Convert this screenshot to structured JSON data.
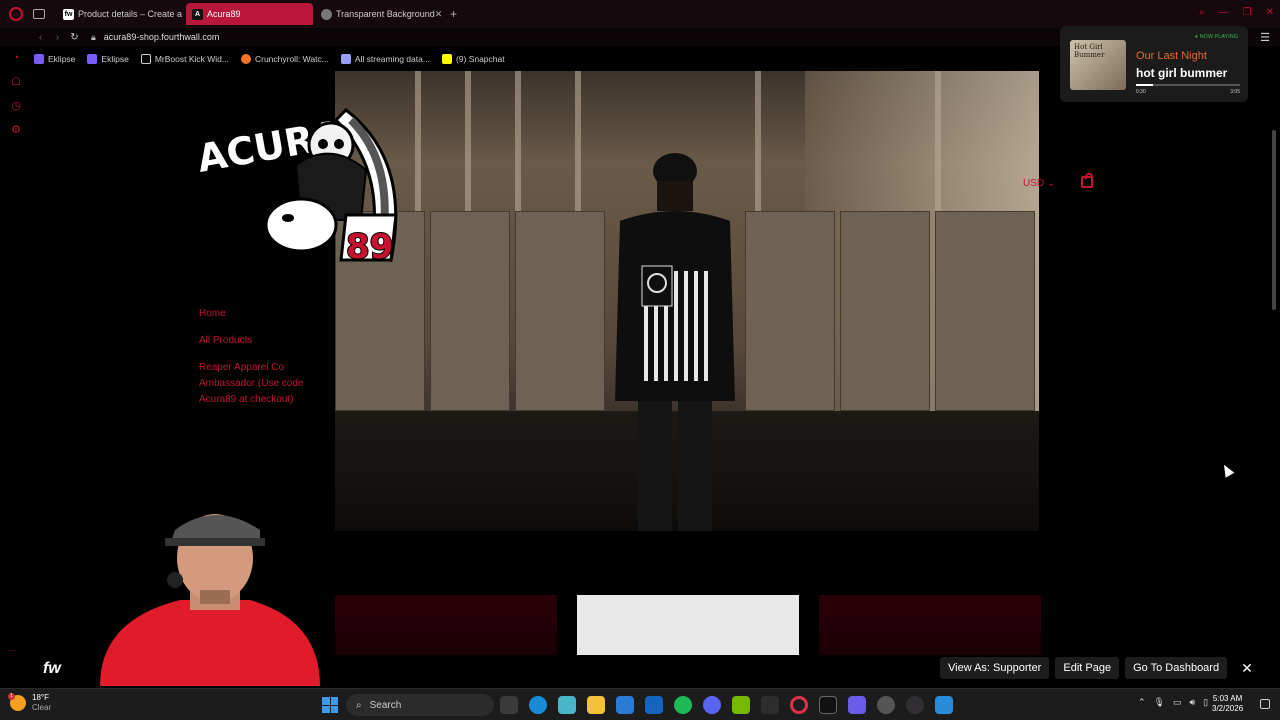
{
  "browser": {
    "tabs": [
      {
        "label": "Product details – Create a",
        "favicon": "fourthwall-icon",
        "active": false
      },
      {
        "label": "Acura89",
        "favicon": "acura89-icon",
        "active": true
      },
      {
        "label": "Transparent Background",
        "favicon": "globe-icon",
        "active": false
      }
    ],
    "url": "acura89-shop.fourthwall.com",
    "bookmarks": [
      {
        "label": "Eklipse",
        "color": "#7b5cff"
      },
      {
        "label": "Eklipse",
        "color": "#7b5cff"
      },
      {
        "label": "MrBoost Kick Wid...",
        "color": "#cccccc"
      },
      {
        "label": "Crunchyroll: Watc...",
        "color": "#f47521"
      },
      {
        "label": "All streaming data...",
        "color": "#9aa0ff"
      },
      {
        "label": "(9) Snapchat",
        "color": "#fffc00"
      }
    ]
  },
  "site": {
    "nav": {
      "home": "Home",
      "all_products": "All Products",
      "ambassador": "Reaper Apparel Co Ambassador (Use code Acura89 at checkout)"
    },
    "currency": "USD",
    "logo_text": "ACURA 89"
  },
  "now_playing": {
    "tag": "● NOW PLAYING",
    "title": "Our Last Night",
    "artist": "hot girl bummer",
    "elapsed": "0:30",
    "duration": "3:05",
    "progress": 0.16,
    "album_art_text": "Hot Girl Bummer"
  },
  "fourthwall_bar": {
    "logo": "fw",
    "view_as": "View As: Supporter",
    "edit_page": "Edit Page",
    "dashboard": "Go To Dashboard"
  },
  "taskbar": {
    "weather_temp": "18°F",
    "weather_cond": "Clear",
    "weather_badge": "1",
    "search": "Search",
    "time": "5:03 AM",
    "date": "3/2/2026"
  },
  "colors": {
    "accent": "#c4122f",
    "tab_active": "#b8173a"
  }
}
